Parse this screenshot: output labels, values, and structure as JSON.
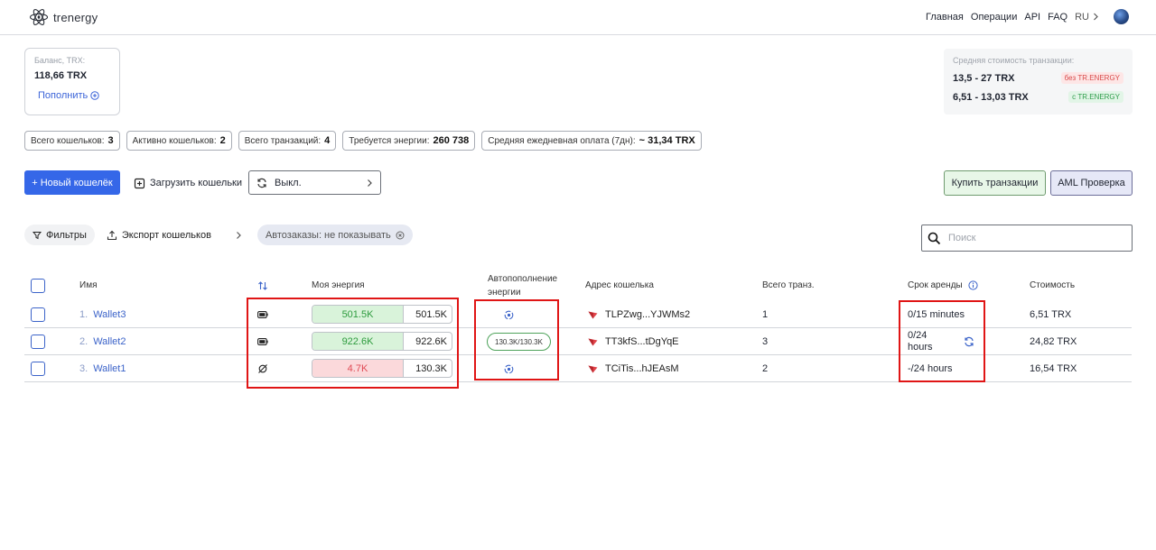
{
  "brand": {
    "name": "trenergy"
  },
  "nav": {
    "items": [
      "Главная",
      "Операции",
      "API",
      "FAQ"
    ],
    "lang": "RU"
  },
  "balance": {
    "label": "Баланс, TRX:",
    "value": "118,66 TRX",
    "topup_label": "Пополнить"
  },
  "avg_cost": {
    "title": "Средняя стоимость транзакции:",
    "rows": [
      {
        "value": "13,5 - 27 TRX",
        "tag": "без TR.ENERGY"
      },
      {
        "value": "6,51 - 13,03 TRX",
        "tag": "с TR.ENERGY"
      }
    ]
  },
  "stats": [
    {
      "label": "Всего кошельков:",
      "value": "3"
    },
    {
      "label": "Активно кошельков:",
      "value": "2"
    },
    {
      "label": "Всего транзакций:",
      "value": "4"
    },
    {
      "label": "Требуется энергии:",
      "value": "260 738"
    },
    {
      "label": "Средняя ежедневная оплата (7дн):",
      "value": "~ 31,34 TRX"
    }
  ],
  "actions": {
    "new_wallet": "+ Новый кошелёк",
    "upload_wallets": "Загрузить кошельки",
    "autorenew_state": "Выкл.",
    "buy_tx": "Купить транзакции",
    "aml_check": "AML Проверка"
  },
  "filters": {
    "filters_label": "Фильтры",
    "export_label": "Экспорт кошельков",
    "autoorders_label": "Автозаказы: не показывать",
    "search_placeholder": "Поиск"
  },
  "table": {
    "headers": {
      "name": "Имя",
      "energy": "Моя энергия",
      "autorefill_line1": "Автопополнение",
      "autorefill_line2": "энергии",
      "address": "Адрес кошелька",
      "total_tx": "Всего транз.",
      "rent_term": "Срок аренды",
      "cost": "Стоимость"
    },
    "rows": [
      {
        "num": "1.",
        "name": "Wallet3",
        "energy_available": "501.5K",
        "energy_total": "501.5K",
        "energy_state": "green",
        "autorefill": "",
        "address": "TLPZwg...YJWMs2",
        "total_tx": "1",
        "rent_line1": "0/15 minutes",
        "rent_line2": "",
        "cost": "6,51 TRX"
      },
      {
        "num": "2.",
        "name": "Wallet2",
        "energy_available": "922.6K",
        "energy_total": "922.6K",
        "energy_state": "green",
        "autorefill": "130.3K/130.3K",
        "address": "TT3kfS...tDgYqE",
        "total_tx": "3",
        "rent_line1": "0/24",
        "rent_line2": "hours",
        "cost": "24,82 TRX"
      },
      {
        "num": "3.",
        "name": "Wallet1",
        "energy_available": "4.7K",
        "energy_total": "130.3K",
        "energy_state": "red",
        "autorefill": "",
        "address": "TCiTis...hJEAsM",
        "total_tx": "2",
        "rent_line1": "-/24 hours",
        "rent_line2": "",
        "cost": "16,54 TRX"
      }
    ]
  },
  "colors": {
    "accent": "#3567e8",
    "highlight_box": "#e01515",
    "energy_green": "#2e9b3e",
    "energy_red": "#e04b55"
  }
}
